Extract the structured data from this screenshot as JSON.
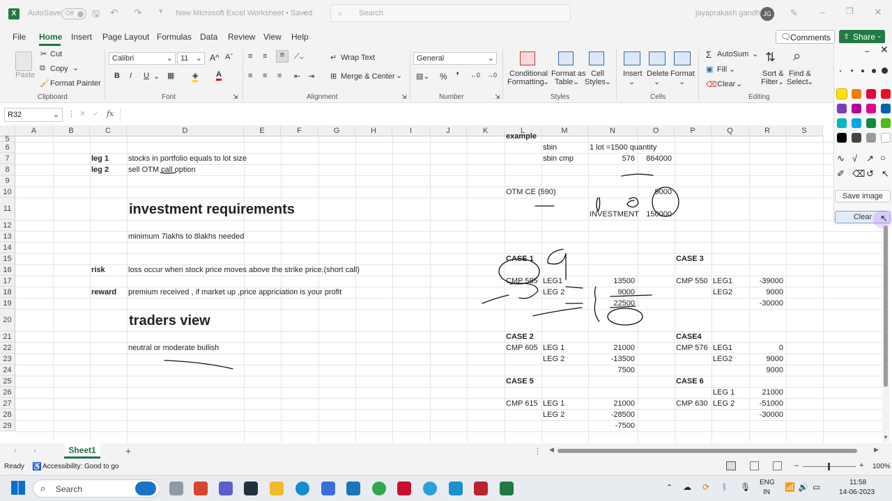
{
  "titlebar": {
    "autosave_label": "AutoSave",
    "autosave_state": "Off",
    "doc_title": "New Microsoft Excel Worksheet • Saved",
    "doc_title_chevron": "⌄",
    "search_placeholder": "Search",
    "user_name": "jayaprakash gandhi",
    "user_initials": "JG"
  },
  "menu": {
    "items": [
      "File",
      "Home",
      "Insert",
      "Page Layout",
      "Formulas",
      "Data",
      "Review",
      "View",
      "Help"
    ],
    "comments_label": "Comments",
    "share_label": "Share"
  },
  "ribbon": {
    "clipboard": {
      "paste": "Paste",
      "cut": "Cut",
      "copy": "Copy",
      "format_painter": "Format Painter",
      "label": "Clipboard"
    },
    "font": {
      "name": "Calibri",
      "size": "11",
      "label": "Font",
      "grow": "A^",
      "shrink": "Aˇ",
      "bold": "B",
      "italic": "I",
      "underline": "U"
    },
    "alignment": {
      "wrap_text": "Wrap Text",
      "merge_center": "Merge & Center",
      "label": "Alignment"
    },
    "number": {
      "format": "General",
      "label": "Number",
      "percent": "%"
    },
    "styles": {
      "conditional": "Conditional",
      "formatting": "Formatting",
      "format_as": "Format as",
      "table": "Table",
      "cell": "Cell",
      "styles": "Styles",
      "label": "Styles"
    },
    "cells": {
      "insert": "Insert",
      "delete": "Delete",
      "format": "Format",
      "label": "Cells"
    },
    "editing": {
      "autosum": "AutoSum",
      "fill": "Fill",
      "clear": "Clear",
      "sort": "Sort &",
      "filter": "Filter",
      "find": "Find &",
      "select": "Select",
      "label": "Editing"
    }
  },
  "formula_bar": {
    "name_box": "R32",
    "fx": "fx",
    "value": ""
  },
  "columns": [
    "A",
    "B",
    "C",
    "D",
    "E",
    "F",
    "G",
    "H",
    "I",
    "J",
    "K",
    "L",
    "M",
    "N",
    "O",
    "P",
    "Q",
    "R",
    "S"
  ],
  "rows": [
    "5",
    "6",
    "7",
    "8",
    "9",
    "10",
    "11",
    "12",
    "13",
    "14",
    "15",
    "16",
    "17",
    "18",
    "19",
    "20",
    "21",
    "22",
    "23",
    "24",
    "25",
    "26",
    "27",
    "28",
    "29"
  ],
  "cells": {
    "L5": "example",
    "M6": "sbin",
    "N6": "1 lot =1500 quantity",
    "C7": "leg 1",
    "D7": "stocks in portfolio equals to lot size",
    "M7": "sbin cmp",
    "N7": "576",
    "O7": "864000",
    "C8": "leg 2",
    "D8": "sell OTM call option",
    "L10": "OTM CE (590)",
    "O10": "9000",
    "D11": "investment requirements",
    "N11": "INVESTMENT",
    "O11": "150000",
    "D13": "minimum 7lakhs  to 8lakhs needed",
    "L15": "CASE 1",
    "P15": "CASE 3",
    "C16": "risk",
    "D16": "loss occur when stock price moves above the strike price.(short call)",
    "L17": "CMP 585",
    "M17": "LEG1",
    "N17": "13500",
    "P17": "CMP 550",
    "Q17": "LEG1",
    "R17": "-39000",
    "C18": "reward",
    "D18": "premium received , if market up ,price appriciation is your profit",
    "M18": "LEG 2",
    "N18": "9000",
    "Q18": "LEG2",
    "R18": "9000",
    "N19": "22500",
    "R19": "-30000",
    "D20": "traders view",
    "L21": "CASE 2",
    "P21": "CASE4",
    "D22": "neutral or moderate bullish",
    "L22": "CMP 605",
    "M22": "LEG 1",
    "N22": "21000",
    "P22": "CMP 576",
    "Q22": "LEG1",
    "R22": "0",
    "M23": "LEG 2",
    "N23": "-13500",
    "Q23": "LEG2",
    "R23": "9000",
    "N24": "7500",
    "R24": "9000",
    "L25": "CASE 5",
    "P25": "CASE 6",
    "Q26": "LEG 1",
    "R26": "21000",
    "L27": "CMP 615",
    "M27": "LEG 1",
    "N27": "21000",
    "P27": "CMP 630",
    "Q27": "LEG 2",
    "R27": "-51000",
    "M28": "LEG 2",
    "N28": "-28500",
    "R28": "-30000",
    "N29": "-7500"
  },
  "pen_panel": {
    "save_label": "Save image",
    "clear_label": "Clear"
  },
  "sheet_tabs": {
    "active": "Sheet1",
    "add": "+"
  },
  "status": {
    "ready": "Ready",
    "accessibility": "Accessibility: Good to go",
    "zoom": "100%"
  },
  "taskbar": {
    "search": "Search",
    "lang1": "ENG",
    "lang2": "IN",
    "time": "11:58",
    "date": "14-06-2023"
  }
}
